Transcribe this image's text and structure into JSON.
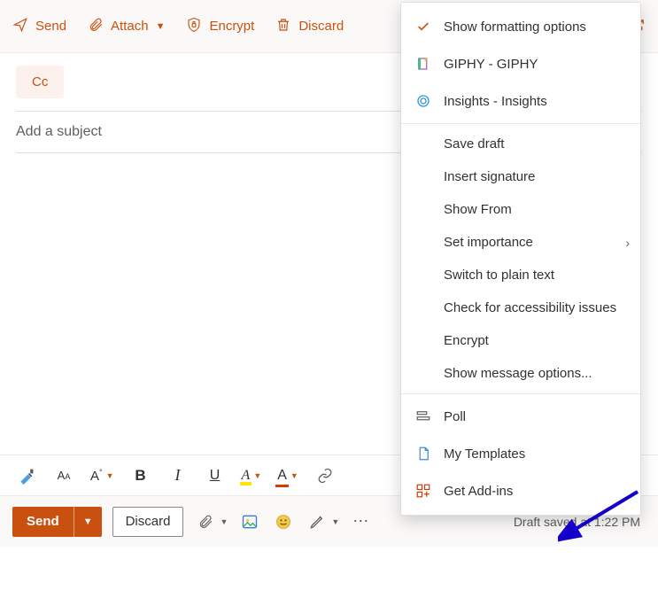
{
  "toolbar": {
    "send": "Send",
    "attach": "Attach",
    "encrypt": "Encrypt",
    "discard": "Discard"
  },
  "compose": {
    "cc": "Cc",
    "subject_placeholder": "Add a subject"
  },
  "format": {
    "bold": "B",
    "italic": "I",
    "underline": "U",
    "highlight_sample": "A",
    "fontcolor_sample": "A"
  },
  "bottom": {
    "send": "Send",
    "discard": "Discard",
    "status": "Draft saved at 1:22 PM"
  },
  "menu": {
    "show_formatting": "Show formatting options",
    "giphy": "GIPHY - GIPHY",
    "insights": "Insights - Insights",
    "save_draft": "Save draft",
    "insert_signature": "Insert signature",
    "show_from": "Show From",
    "set_importance": "Set importance",
    "switch_plain": "Switch to plain text",
    "accessibility": "Check for accessibility issues",
    "encrypt": "Encrypt",
    "message_options": "Show message options...",
    "poll": "Poll",
    "my_templates": "My Templates",
    "get_addins": "Get Add-ins"
  }
}
